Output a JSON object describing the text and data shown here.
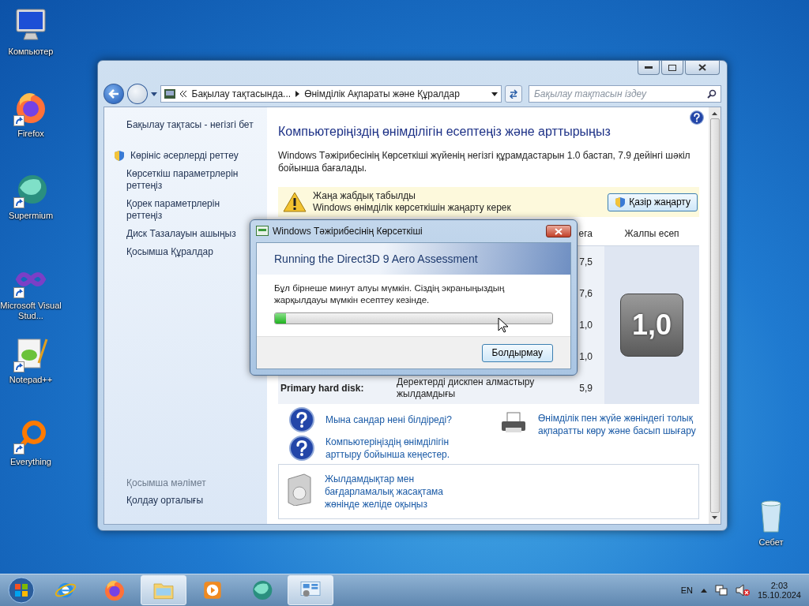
{
  "desktop_icons": [
    {
      "label": "Компьютер",
      "kind": "computer",
      "shortcut": false
    },
    {
      "label": "Firefox",
      "kind": "firefox",
      "shortcut": true
    },
    {
      "label": "Supermium",
      "kind": "supermium",
      "shortcut": true
    },
    {
      "label": "Microsoft Visual Stud...",
      "kind": "vs",
      "shortcut": true
    },
    {
      "label": "Notepad++",
      "kind": "notepad",
      "shortcut": true
    },
    {
      "label": "Everything",
      "kind": "everything",
      "shortcut": true
    },
    {
      "label": "Себет",
      "kind": "bin",
      "shortcut": false
    }
  ],
  "window": {
    "address": {
      "crumbs": [
        "Бақылау тақтасында...",
        "Өнімділік Ақпараты және Құралдар"
      ]
    },
    "search": {
      "placeholder": "Бақылау тақтасын іздеу"
    },
    "sidebar": {
      "home": "Бақылау тақтасы - негізгі бет",
      "links": [
        {
          "label": "Көрініс әсерлерді реттеу",
          "shield": true
        },
        {
          "label": "Көрсеткіш параметрлерін реттеңіз",
          "shield": false
        },
        {
          "label": "Қорек параметрлерін реттеңіз",
          "shield": false
        },
        {
          "label": "Диск Тазалауын ашыңыз",
          "shield": false
        },
        {
          "label": "Қосымша Құралдар",
          "shield": false
        }
      ],
      "see_also_title": "Қосымша мәлімет",
      "see_also": [
        "Қолдау орталығы"
      ]
    },
    "main": {
      "title": "Компьютеріңіздің өнімділігін есептеңіз және арттырыңыз",
      "description": "Windows Тәжірибесінің Көрсеткіші жүйенің негізгі құрамдастарын 1.0 бастап, 7.9 дейінгі шәкіл бойынша бағалады.",
      "notice": {
        "lines": [
          "Жаңа жабдық табылды",
          "Windows өнімділік көрсеткішін жаңарту керек"
        ],
        "button": "Қазір жаңарту"
      },
      "table": {
        "columns": [
          "ега",
          "Жалпы есеп"
        ],
        "rows": [
          {
            "score": "7,5"
          },
          {
            "score": "7,6"
          },
          {
            "score": "1,0"
          },
          {
            "score": "1,0"
          },
          {
            "component": "Primary hard disk:",
            "description": "Деректерді дискпен алмастыру жылдамдығы",
            "score": "5,9"
          }
        ],
        "base_score": "1,0"
      },
      "help_links": [
        "Мына сандар нені білдіреді?",
        "Компьютеріңіздің өнімділігін арттыру бойынша кеңестер."
      ],
      "print_link": "Өнімділік пен жүйе жөніндегі толық ақпаратты көру және басып шығару",
      "online_link": "Жылдамдықтар мен бағдарламалық жасақтама жөнінде желіде оқыңыз"
    }
  },
  "dialog": {
    "title": "Windows Тәжірибесінің Көрсеткіші",
    "heading": "Running the Direct3D 9 Aero Assessment",
    "message": "Бұл бірнеше минут алуы мүмкін. Сіздің экраныңыздың жарқылдауы мүмкін есептеу кезінде.",
    "progress": {
      "level": 0.04
    },
    "button": "Болдырмау"
  },
  "taskbar": {
    "apps": [
      {
        "kind": "ie",
        "open": false
      },
      {
        "kind": "firefox",
        "open": false
      },
      {
        "kind": "explorer",
        "open": true
      },
      {
        "kind": "media",
        "open": false
      },
      {
        "kind": "supermium",
        "open": false
      },
      {
        "kind": "control",
        "open": true
      }
    ],
    "language": "EN",
    "time": "2:03",
    "date": "15.10.2024"
  }
}
